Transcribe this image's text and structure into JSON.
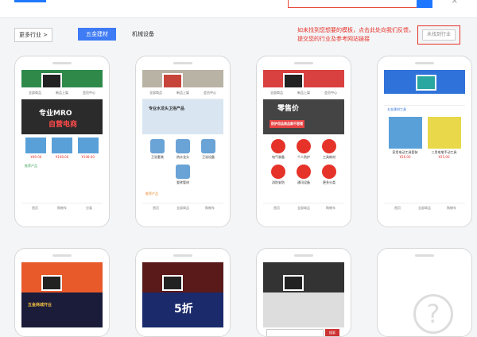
{
  "top": {
    "close": "×"
  },
  "filters": {
    "more_label": "更多行业 >",
    "tab_active": "五金建材",
    "tab_other": "机械设备"
  },
  "hint": {
    "text": "如未找到您想要的模板，点击此处向我们反馈，提交您的行业及参考网站链接",
    "button": "未找到行业"
  },
  "phones": [
    {
      "nav": [
        "全部商品",
        "新品上架",
        "会员中心"
      ],
      "banner_top": "专业MRO",
      "banner_bottom": "自营电商",
      "prices": [
        "¥49.00",
        "¥108.00",
        "¥108.00"
      ],
      "section": "推荐产品",
      "bottom": [
        "首页",
        "购物车",
        "分类"
      ]
    },
    {
      "nav": [
        "全部商品",
        "新品上架",
        "会员中心"
      ],
      "banner_top": "专业水龙头卫浴产品",
      "features": [
        "卫浴套装",
        "热水龙头",
        "卫浴设备",
        "瓷砖管材"
      ],
      "section": "推荐产品",
      "bottom": [
        "首页",
        "全部商品",
        "购物车"
      ]
    },
    {
      "nav": [
        "全部商品",
        "新品上架",
        "会员中心"
      ],
      "banner_top": "零售价",
      "banner_bottom": "防护用品商品都不容错",
      "icons": [
        "电气装备",
        "个人防护",
        "工具耗材",
        "消防安防",
        "通讯设备",
        "更多分类"
      ],
      "bottom": [
        "首页",
        "全部商品",
        "购物车"
      ]
    },
    {
      "section": "五金建材工具",
      "products": [
        "家用电动工具套装",
        "三用电笔手动工具"
      ],
      "prices": [
        "¥26.00",
        "¥25.00"
      ],
      "bottom": [
        "首页",
        "全部商品",
        "购物车"
      ]
    },
    {
      "banner_top": "五金商城开业",
      "bottom": []
    },
    {
      "banner_top": "5折",
      "bottom": []
    },
    {
      "search_btn": "搜索",
      "bottom": []
    },
    {
      "qmark": "?",
      "bottom": []
    }
  ]
}
